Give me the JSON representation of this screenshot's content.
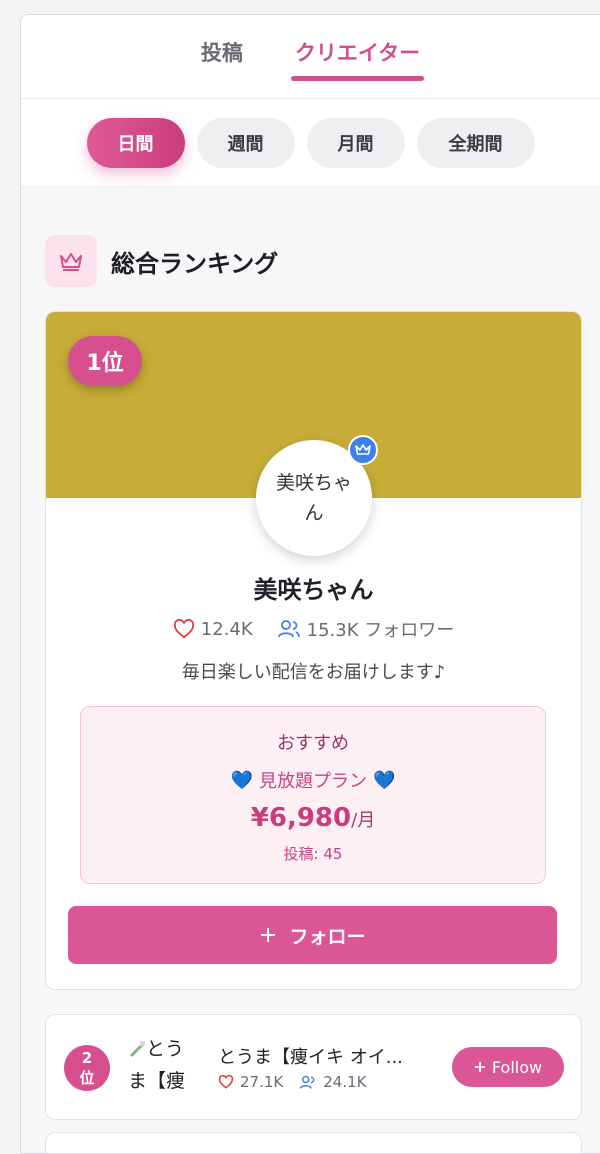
{
  "tabs": [
    {
      "label": "投稿",
      "active": false
    },
    {
      "label": "クリエイター",
      "active": true
    }
  ],
  "periods": [
    {
      "label": "日間",
      "active": true
    },
    {
      "label": "週間",
      "active": false
    },
    {
      "label": "月間",
      "active": false
    },
    {
      "label": "全期間",
      "active": false
    }
  ],
  "section": {
    "title": "総合ランキング",
    "icon": "crown-icon"
  },
  "top_creator": {
    "rank": "1位",
    "avatar_alt": "美咲ちゃん",
    "name": "美咲ちゃん",
    "likes": "12.4K",
    "followers": "15.3K フォロワー",
    "bio": "毎日楽しい配信をお届けします♪",
    "plan": {
      "label": "おすすめ",
      "name": "見放題プラン",
      "emoji_left": "💙",
      "emoji_right": "💙",
      "price": "¥6,980",
      "per": "/月",
      "posts": "投稿: 45"
    },
    "follow_label": "フォロー"
  },
  "second_creator": {
    "rank_num": "2",
    "rank_suffix": "位",
    "avatar_alt": "とうま【痩",
    "name": "とうま【痩イキ オイ...",
    "likes": "27.1K",
    "followers": "24.1K",
    "follow_label": "Follow"
  },
  "colors": {
    "accent": "#d6508f",
    "banner": "#c7ad37",
    "blue": "#3f7fe8"
  }
}
